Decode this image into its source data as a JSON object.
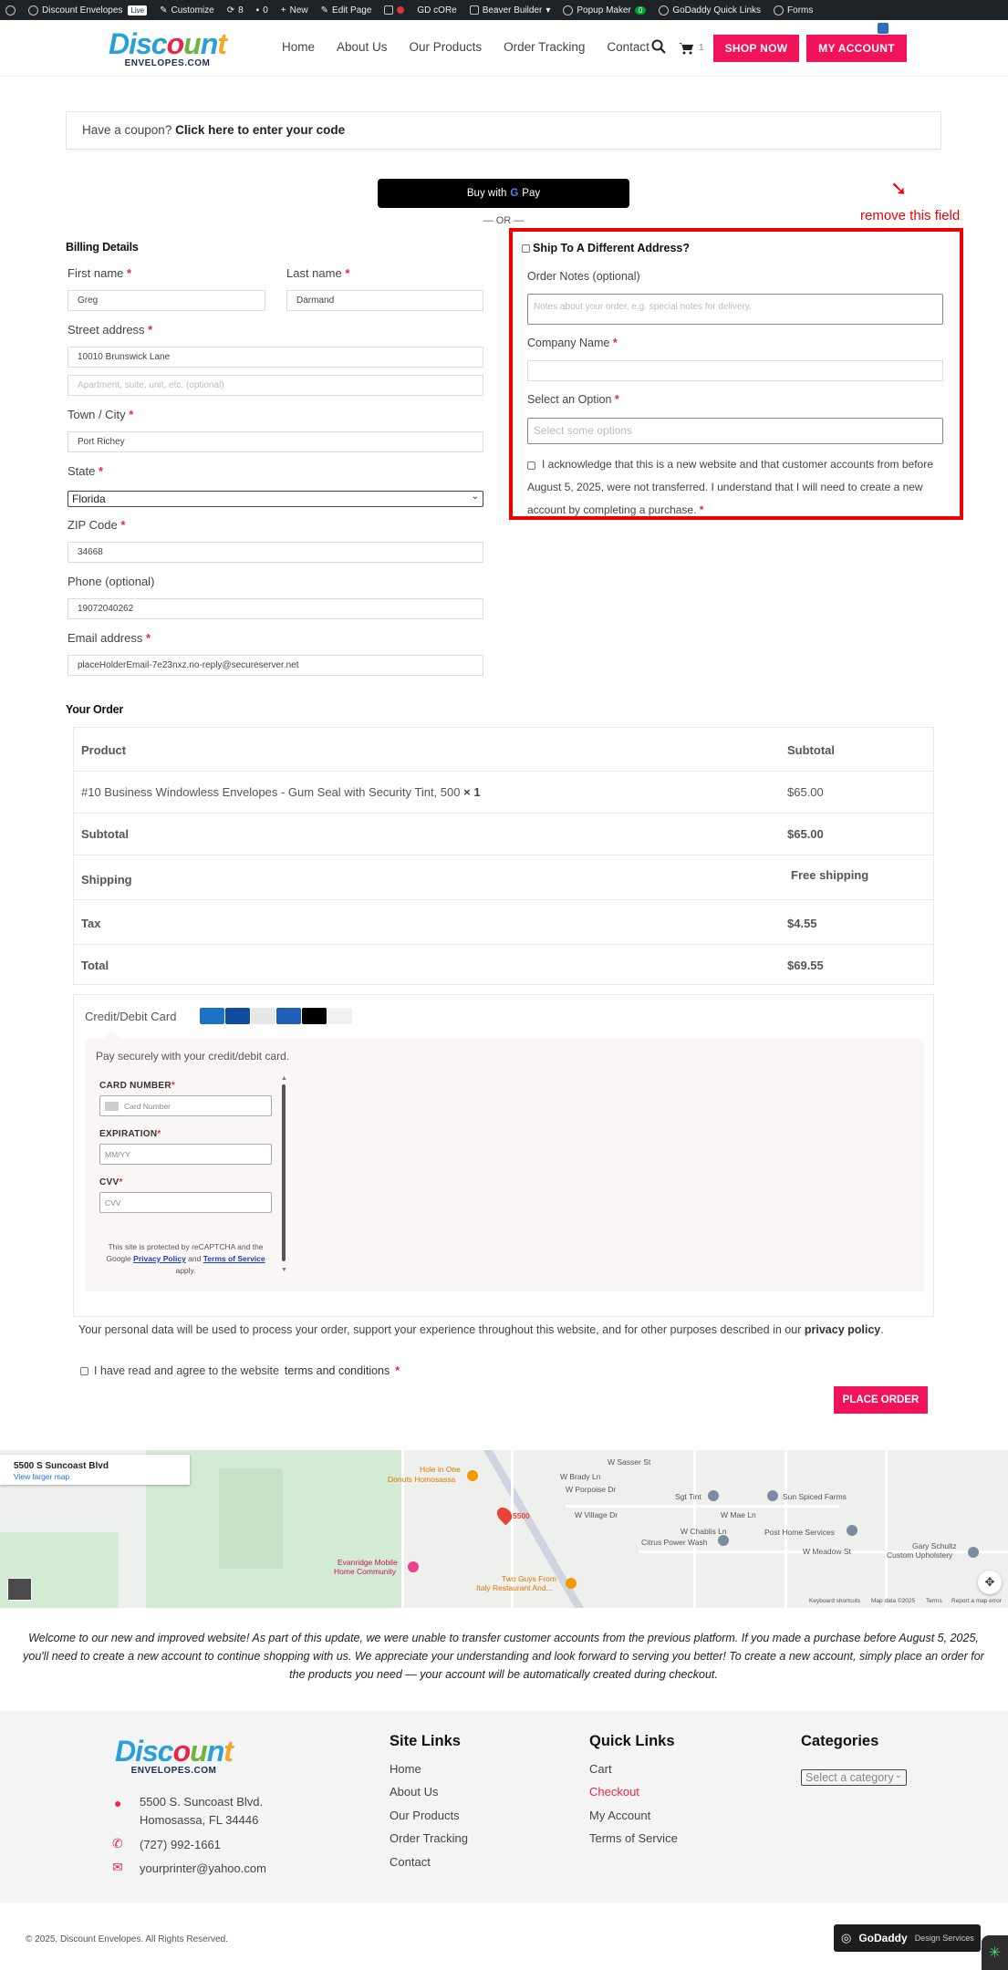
{
  "admin_bar": {
    "site": "Discount Envelopes",
    "live": "Live",
    "customize": "Customize",
    "updates": "8",
    "comments": "0",
    "new": "New",
    "edit_page": "Edit Page",
    "gd_core": "GD cORe",
    "beaver": "Beaver Builder",
    "popup": "Popup Maker",
    "popup_count": "0",
    "quick_links": "GoDaddy Quick Links",
    "forms": "Forms"
  },
  "brand": {
    "word1": "Disc",
    "word2": "ount",
    "sub": "ENVELOPES.COM"
  },
  "nav": [
    "Home",
    "About Us",
    "Our Products",
    "Order Tracking",
    "Contact"
  ],
  "cart_count": "1",
  "header_buttons": {
    "shop": "SHOP NOW",
    "account": "MY ACCOUNT"
  },
  "coupon": {
    "text": "Have a coupon?",
    "link": "Click here to enter your code"
  },
  "gpay": {
    "prefix": "Buy with",
    "brand": "Pay"
  },
  "or_divider": "— OR —",
  "annotation": "remove this field",
  "billing": {
    "heading": "Billing Details",
    "first_name_label": "First name",
    "first_name": "Greg",
    "last_name_label": "Last name",
    "last_name": "Darmand",
    "street_label": "Street address",
    "street": "10010 Brunswick Lane",
    "street2_placeholder": "Apartment, suite, unit, etc. (optional)",
    "town_label": "Town / City",
    "town": "Port Richey",
    "state_label": "State",
    "state": "Florida",
    "zip_label": "ZIP Code",
    "zip": "34668",
    "phone_label": "Phone (optional)",
    "phone": "19072040262",
    "email_label": "Email address",
    "email": "placeHolderEmail-7e23nxz.no-reply@secureserver.net"
  },
  "shipping": {
    "ship_label": "Ship To A Different Address?",
    "notes_label": "Order Notes (optional)",
    "notes_placeholder": "Notes about your order, e.g. special notes for delivery.",
    "company_label": "Company Name",
    "option_label": "Select an Option",
    "option_placeholder": "Select some options",
    "acknowledge": "I acknowledge that this is a new website and that customer accounts from before August 5, 2025, were not transferred. I understand that I will need to create a new account by completing a purchase."
  },
  "order": {
    "heading": "Your Order",
    "col_product": "Product",
    "col_subtotal": "Subtotal",
    "item": "#10 Business Windowless Envelopes - Gum Seal with Security Tint, 500",
    "qty": "× 1",
    "item_price": "$65.00",
    "subtotal_label": "Subtotal",
    "subtotal": "$65.00",
    "shipping_label": "Shipping",
    "shipping": "Free shipping",
    "tax_label": "Tax",
    "tax": "$4.55",
    "total_label": "Total",
    "total": "$69.55"
  },
  "payment": {
    "method": "Credit/Debit Card",
    "card_colors": [
      "#1a73c7",
      "#0f4c9e",
      "#e7e7e7",
      "#1f5fb8",
      "#000000",
      "#f1f1f1"
    ],
    "secure_text": "Pay securely with your credit/debit card.",
    "card_number_label": "CARD NUMBER",
    "card_number_placeholder": "Card Number",
    "expiration_label": "EXPIRATION",
    "expiration_placeholder": "MM/YY",
    "cvv_label": "CVV",
    "cvv_placeholder": "CVV",
    "captcha_1": "This site is protected by reCAPTCHA and the",
    "captcha_2": "Google",
    "privacy_policy": "Privacy Policy",
    "and": "and",
    "terms_of_service": "Terms of Service",
    "apply": "apply."
  },
  "privacy_note": "Your personal data will be used to process your order, support your experience throughout this website, and for other purposes described in our",
  "privacy_link": "privacy policy",
  "agree_text": "I have read and agree to the website",
  "terms_link": "terms and conditions",
  "place_order": "PLACE ORDER",
  "map": {
    "address": "5500 S Suncoast Blvd",
    "larger": "View larger map",
    "pin": "5500",
    "hole_in_one": "Hole in One",
    "hole_in_one_2": "Donuts Homosassa",
    "sgt_tint": "Sgt Tint",
    "sun_spiced": "Sun Spiced Farms",
    "post_home": "Post Home Services",
    "citrus": "Citrus Power Wash",
    "gary": "Gary Schultz",
    "gary2": "Custom Upholstery",
    "evanridge": "Evanridge Mobile",
    "evanridge2": "Home Community",
    "two_guys": "Two Guys From",
    "two_guys2": "Italy Restaurant And...",
    "w_sasser": "W Sasser St",
    "w_brady": "W Brady Ln",
    "w_porpoise": "W Porpoise Dr",
    "w_village": "W Village Dr",
    "w_chablis": "W Chablis Ln",
    "w_mae": "W Mae Ln",
    "w_meadow": "W Meadow St",
    "keyboard": "Keyboard shortcuts",
    "map_data": "Map data ©2025",
    "terms": "Terms",
    "report": "Report a map error"
  },
  "welcome": "Welcome to our new and improved website! As part of this update, we were unable to transfer customer accounts from the previous platform. If you made a purchase before August 5, 2025, you'll need to create a new account to continue shopping with us. We appreciate your understanding and look forward to serving you better! To create a new account, simply place an order for the products you need — your account will be automatically created during checkout.",
  "footer": {
    "address1": "5500 S. Suncoast Blvd.",
    "address2": "Homosassa, FL 34446",
    "phone": "(727) 992-1661",
    "email": "yourprinter@yahoo.com",
    "site_links_title": "Site Links",
    "site_links": [
      "Home",
      "About Us",
      "Our Products",
      "Order Tracking",
      "Contact"
    ],
    "quick_links_title": "Quick Links",
    "quick_links": [
      "Cart",
      "Checkout",
      "My Account",
      "Terms of Service"
    ],
    "categories_title": "Categories",
    "category_select": "Select a category",
    "copyright": "© 2025, Discount Envelopes. All Rights Reserved.",
    "gd_brand": "GoDaddy",
    "gd_services": "Design Services"
  },
  "colors": {
    "accent": "#f0135a",
    "annotation": "#e00000",
    "checkout_link": "#e8254b"
  }
}
